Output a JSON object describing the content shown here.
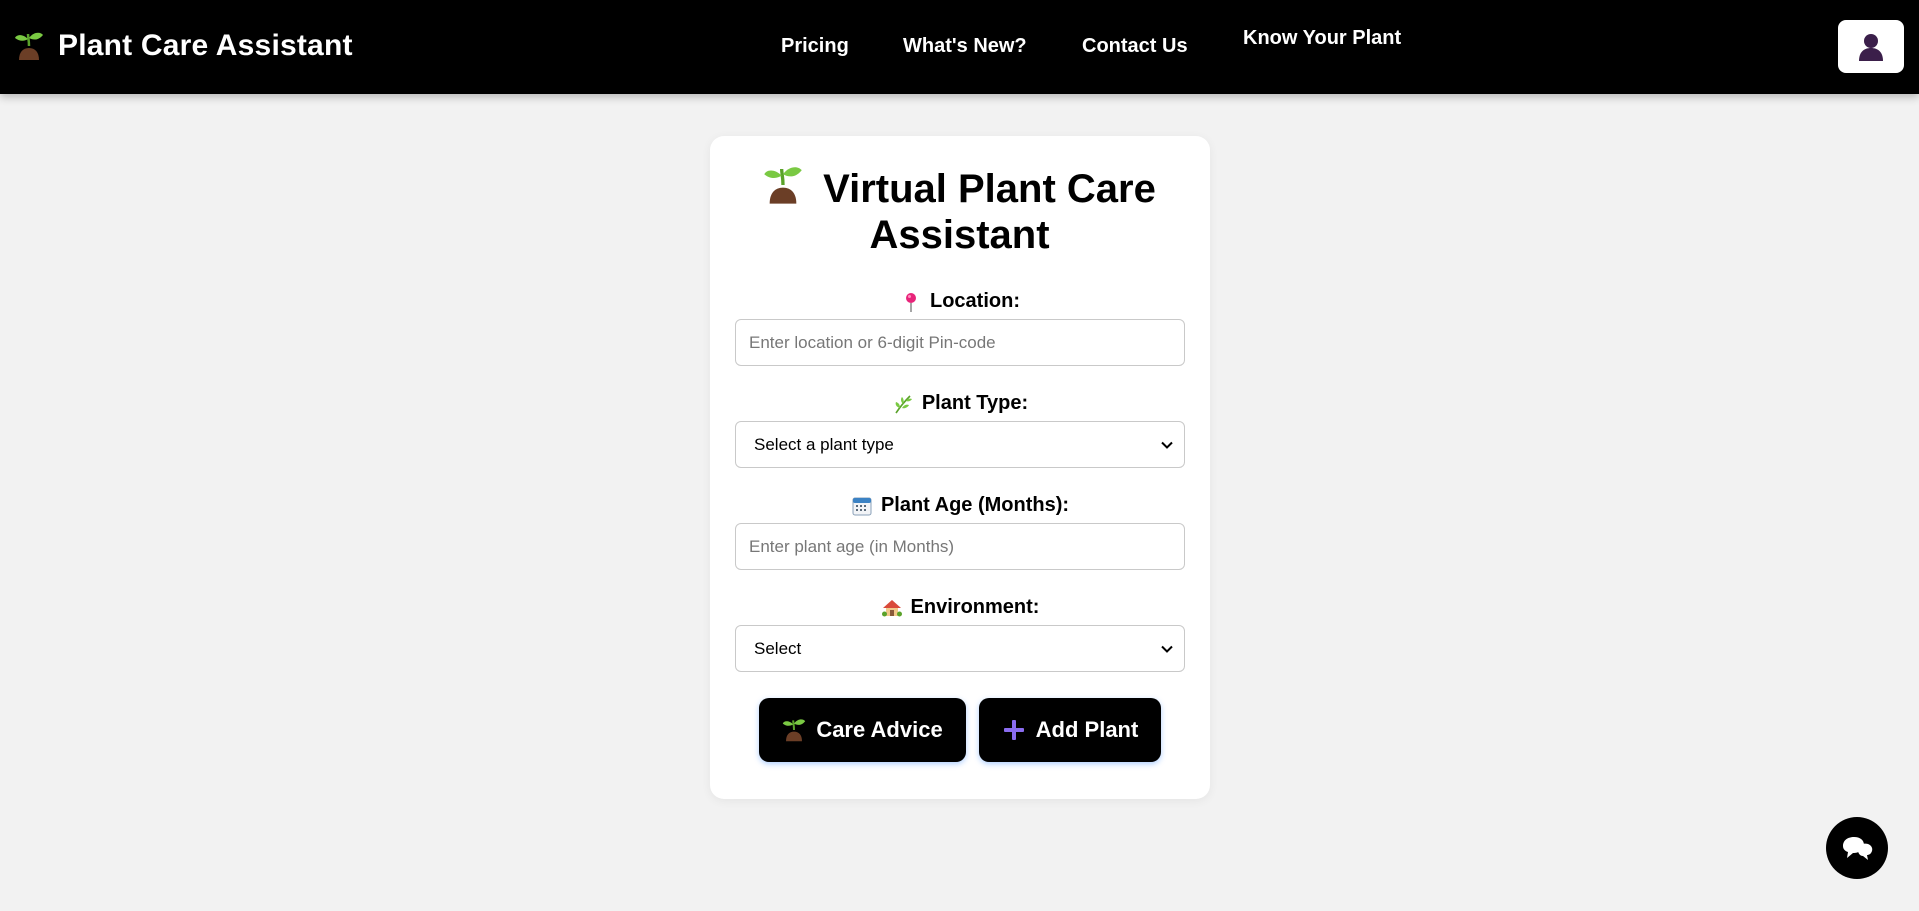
{
  "navbar": {
    "brand": "Plant Care Assistant",
    "links": [
      "Pricing",
      "What's New?",
      "Contact Us",
      "Know Your Plant"
    ]
  },
  "card": {
    "title_line1": "Virtual Plant Care",
    "title_line2": "Assistant",
    "location": {
      "label": "Location:",
      "placeholder": "Enter location or 6-digit Pin-code"
    },
    "plant_type": {
      "label": "Plant Type:",
      "selected": "Select a plant type"
    },
    "plant_age": {
      "label": "Plant Age (Months):",
      "placeholder": "Enter plant age (in Months)"
    },
    "environment": {
      "label": "Environment:",
      "selected": "Select"
    },
    "buttons": {
      "care_advice": "Care Advice",
      "add_plant": "Add Plant"
    }
  },
  "icons": {
    "brand": "seedling-icon",
    "profile": "user-silhouette-icon",
    "location": "round-pushpin-icon",
    "plant_type": "herb-icon",
    "plant_age": "calendar-icon",
    "environment": "house-with-garden-icon",
    "care_advice": "seedling-icon",
    "add_plant": "plus-icon",
    "chat": "chat-bubbles-icon"
  },
  "colors": {
    "navbar_bg": "#000000",
    "page_bg": "#f2f2f2",
    "card_bg": "#ffffff",
    "button_bg": "#000000",
    "plus_accent": "#8a6cf0"
  }
}
